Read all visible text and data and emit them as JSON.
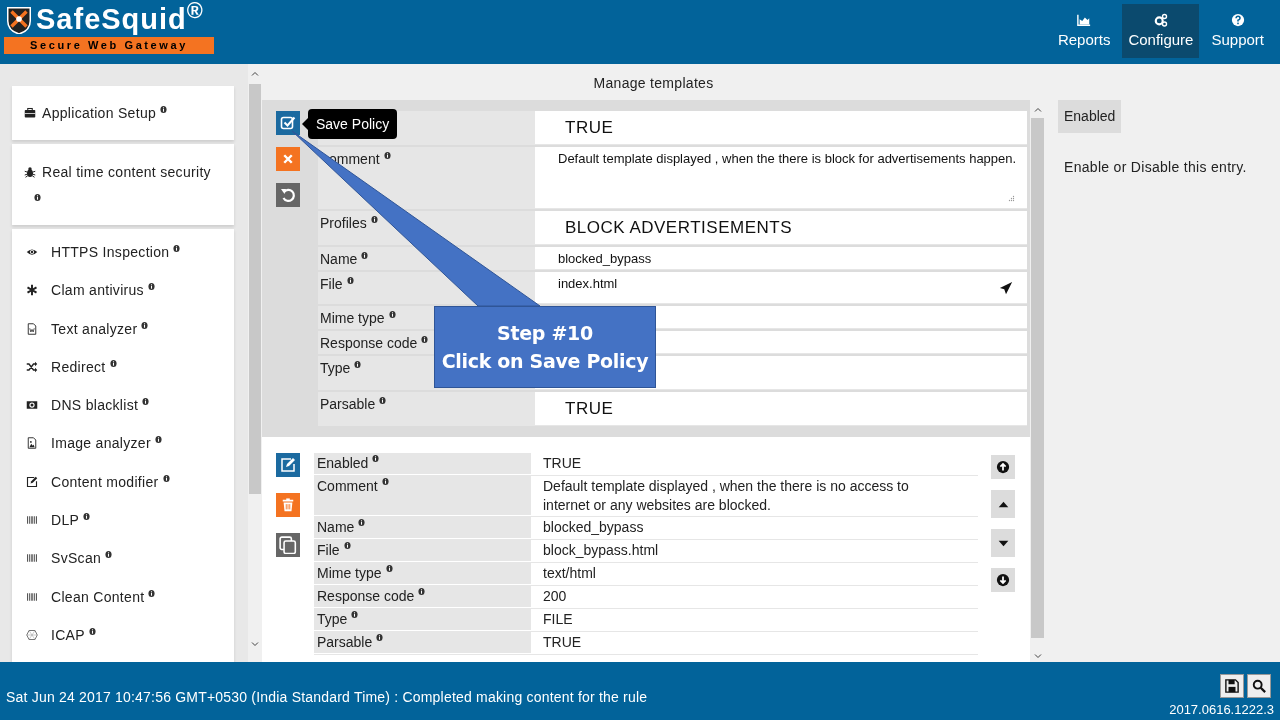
{
  "header": {
    "logo": {
      "name": "SafeSquid$^{®}$",
      "tagline": "Secure Web Gateway"
    },
    "nav": [
      {
        "label": "Reports",
        "selected": false
      },
      {
        "label": "Configure",
        "selected": true
      },
      {
        "label": "Support",
        "selected": false
      }
    ]
  },
  "sidebar": {
    "sections": [
      {
        "items": [
          {
            "label": "Application Setup"
          }
        ]
      },
      {
        "items": [
          {
            "label": "Real time content security"
          }
        ]
      },
      {
        "items": [
          {
            "label": "HTTPS Inspection"
          },
          {
            "label": "Clam antivirus"
          },
          {
            "label": "Text analyzer"
          },
          {
            "label": "Redirect"
          },
          {
            "label": "DNS blacklist"
          },
          {
            "label": "Image analyzer"
          },
          {
            "label": "Content modifier"
          },
          {
            "label": "DLP"
          },
          {
            "label": "SvScan"
          },
          {
            "label": "Clean Content"
          },
          {
            "label": "ICAP"
          }
        ]
      }
    ]
  },
  "main": {
    "title": "Manage templates",
    "edit_form": {
      "tooltip": "Save Policy",
      "rows": [
        {
          "kind": "large",
          "value": "TRUE"
        },
        {
          "kind": "textarea",
          "label": "omment",
          "value": "Default template displayed , when the there is block for advertisements happen."
        },
        {
          "kind": "large",
          "label": "Profiles",
          "value": "BLOCK ADVERTISEMENTS"
        },
        {
          "kind": "text",
          "label": "Name",
          "value": "blocked_bypass"
        },
        {
          "kind": "file",
          "label": "File",
          "value": "index.html"
        },
        {
          "kind": "text",
          "label": "Mime type"
        },
        {
          "kind": "text",
          "label": "Response code"
        },
        {
          "kind": "large",
          "label": "Type"
        },
        {
          "kind": "large",
          "label": "Parsable",
          "value": "TRUE"
        }
      ]
    },
    "record": {
      "rows": [
        {
          "label": "Enabled",
          "value": "TRUE"
        },
        {
          "label": "Comment",
          "value": "Default template displayed , when the there is no access to internet or any websites are blocked."
        },
        {
          "label": "Name",
          "value": "blocked_bypass"
        },
        {
          "label": "File",
          "value": "block_bypass.html"
        },
        {
          "label": "Mime type",
          "value": "text/html"
        },
        {
          "label": "Response code",
          "value": "200"
        },
        {
          "label": "Type",
          "value": "FILE"
        },
        {
          "label": "Parsable",
          "value": "TRUE"
        }
      ]
    }
  },
  "help": {
    "tag": "Enabled",
    "text": "Enable or Disable this entry."
  },
  "callout": {
    "lines": [
      "Step #10",
      "Click on Save Policy"
    ]
  },
  "status_bar": {
    "message": "Sat Jun 24 2017 10:47:56 GMT+0530 (India Standard Time) : Completed making content for the rule",
    "version": "2017.0616.1222.3"
  }
}
